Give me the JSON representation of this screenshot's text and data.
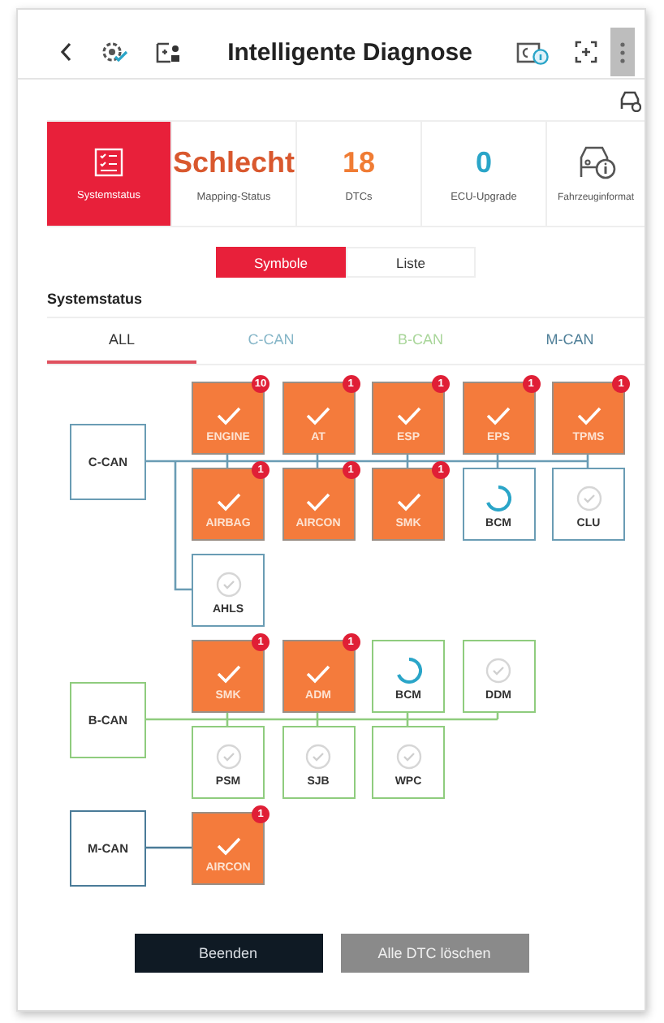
{
  "header": {
    "title": "Intelligente Diagnose"
  },
  "summary": [
    {
      "kind": "status",
      "label": "Systemstatus",
      "selected": true
    },
    {
      "kind": "value",
      "value": "Schlecht",
      "label": "Mapping-Status",
      "color": "#d9582e",
      "selected": false
    },
    {
      "kind": "value",
      "value": "18",
      "label": "DTCs",
      "color": "#f07c34",
      "selected": false
    },
    {
      "kind": "value",
      "value": "0",
      "label": "ECU-Upgrade",
      "color": "#2aa5c8",
      "selected": false
    },
    {
      "kind": "vehicle",
      "label": "Fahrzeuginformat",
      "selected": false
    }
  ],
  "view_toggle": [
    {
      "label": "Symbole",
      "selected": true
    },
    {
      "label": "Liste",
      "selected": false
    }
  ],
  "section_title": "Systemstatus",
  "tabs": [
    {
      "label": "ALL",
      "selected": true,
      "color": "#333333"
    },
    {
      "label": "C-CAN",
      "selected": false,
      "color": "#86b6c8"
    },
    {
      "label": "B-CAN",
      "selected": false,
      "color": "#a9d69a"
    },
    {
      "label": "M-CAN",
      "selected": false,
      "color": "#4f7f98"
    }
  ],
  "buses": [
    {
      "name": "C-CAN",
      "color": "#6a9cb4",
      "rows": [
        [
          {
            "label": "ENGINE",
            "kind": "fault",
            "badge": "10"
          },
          {
            "label": "AT",
            "kind": "fault",
            "badge": "1"
          },
          {
            "label": "ESP",
            "kind": "fault",
            "badge": "1"
          },
          {
            "label": "EPS",
            "kind": "fault",
            "badge": "1"
          },
          {
            "label": "TPMS",
            "kind": "fault",
            "badge": "1"
          }
        ],
        [
          {
            "label": "AIRBAG",
            "kind": "fault",
            "badge": "1"
          },
          {
            "label": "AIRCON",
            "kind": "fault",
            "badge": "1"
          },
          {
            "label": "SMK",
            "kind": "fault",
            "badge": "1"
          },
          {
            "label": "BCM",
            "kind": "loading"
          },
          {
            "label": "CLU",
            "kind": "ok"
          }
        ],
        [
          {
            "label": "AHLS",
            "kind": "ok"
          }
        ]
      ]
    },
    {
      "name": "B-CAN",
      "color": "#8fcc7e",
      "rows": [
        [
          {
            "label": "SMK",
            "kind": "fault",
            "badge": "1"
          },
          {
            "label": "ADM",
            "kind": "fault",
            "badge": "1"
          },
          {
            "label": "BCM",
            "kind": "loading"
          },
          {
            "label": "DDM",
            "kind": "ok"
          }
        ],
        [
          {
            "label": "PSM",
            "kind": "ok"
          },
          {
            "label": "SJB",
            "kind": "ok"
          },
          {
            "label": "WPC",
            "kind": "ok"
          }
        ]
      ]
    },
    {
      "name": "M-CAN",
      "color": "#4a7b98",
      "rows": [
        [
          {
            "label": "AIRCON",
            "kind": "fault",
            "badge": "1"
          }
        ]
      ]
    }
  ],
  "buttons": [
    {
      "label": "Beenden",
      "kind": "primary"
    },
    {
      "label": "Alle DTC löschen",
      "kind": "secondary"
    }
  ]
}
